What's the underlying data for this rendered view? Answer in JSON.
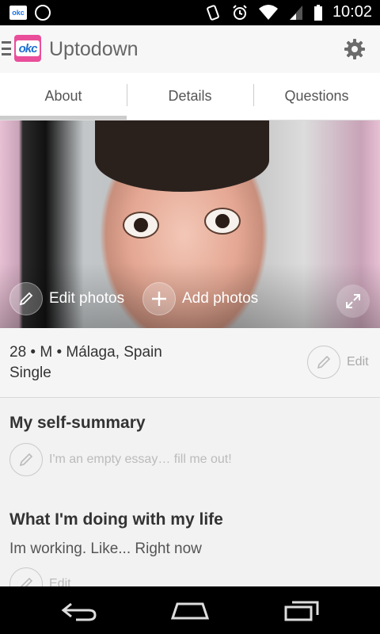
{
  "status_bar": {
    "time": "10:02",
    "notification_icons": [
      "okcupid-icon",
      "whatsapp-icon"
    ],
    "system_icons": [
      "vibrate-icon",
      "alarm-icon",
      "wifi-icon",
      "signal-icon",
      "battery-icon"
    ]
  },
  "app_bar": {
    "title": "Uptodown",
    "logo_text": "okc"
  },
  "tabs": [
    {
      "label": "About",
      "selected": true
    },
    {
      "label": "Details",
      "selected": false
    },
    {
      "label": "Questions",
      "selected": false
    }
  ],
  "photo": {
    "edit_label": "Edit photos",
    "add_label": "Add photos"
  },
  "info": {
    "line1": "28 • M • Málaga, Spain",
    "line2": "Single",
    "edit_label": "Edit"
  },
  "essays": [
    {
      "title": "My self-summary",
      "placeholder": "I'm an empty essay… fill me out!"
    },
    {
      "title": "What I'm doing with my life",
      "text": "Im working. Like... Right now",
      "edit_label": "Edit"
    }
  ],
  "colors": {
    "accent": "#e94e9a",
    "logo_blue": "#1c6fd1",
    "background": "#f2f2f2"
  }
}
